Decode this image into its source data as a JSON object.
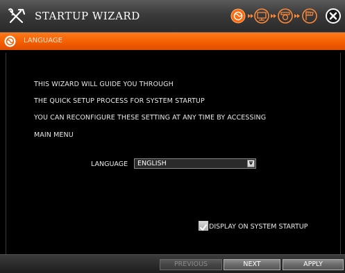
{
  "title": {
    "text": "STARTUP WIZARD",
    "logo_icon": "tools-icon"
  },
  "steps": [
    {
      "name": "language-step-icon",
      "active": true
    },
    {
      "name": "display-step-icon",
      "active": false
    },
    {
      "name": "camera-step-icon",
      "active": false
    },
    {
      "name": "finish-flag-step-icon",
      "active": false
    }
  ],
  "close_icon": "close-icon",
  "section": {
    "title": "LANGUAGE",
    "icon": "globe-icon"
  },
  "messages": [
    "THIS WIZARD WILL GUIDE YOU THROUGH",
    "THE  QUICK SETUP PROCESS FOR SYSTEM STARTUP",
    "YOU CAN RECONFIGURE THESE SETTING AT ANY TIME BY ACCESSING",
    "MAIN MENU"
  ],
  "language": {
    "label": "LANGUAGE",
    "value": "ENGLISH"
  },
  "display_on_startup": {
    "label": "DISPLAY ON SYSTEM STARTUP",
    "checked": true
  },
  "buttons": {
    "previous": "PREVIOUS",
    "next": "NEXT",
    "apply": "APPLY"
  },
  "colors": {
    "accent": "#f25c00",
    "background": "#000000",
    "step_active": "#ff6a10",
    "step_inactive": "#ff8a3a"
  }
}
